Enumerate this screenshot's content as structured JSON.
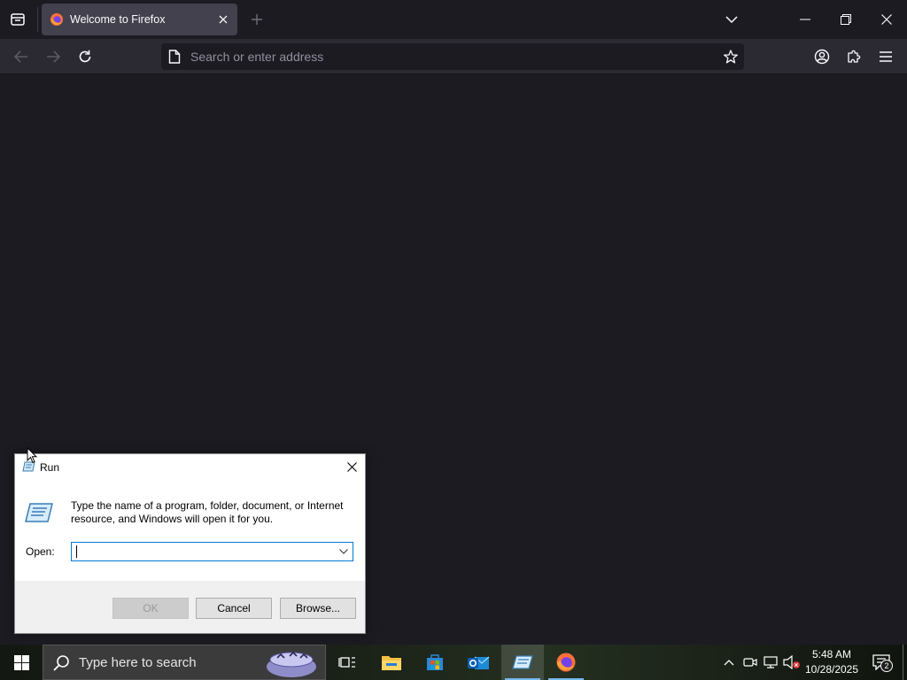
{
  "browser": {
    "tab_title": "Welcome to Firefox",
    "address_placeholder": "Search or enter address"
  },
  "run_dialog": {
    "title": "Run",
    "description": "Type the name of a program, folder, document, or Internet resource, and Windows will open it for you.",
    "open_label": "Open:",
    "open_value": "",
    "ok_label": "OK",
    "cancel_label": "Cancel",
    "browse_label": "Browse..."
  },
  "taskbar": {
    "search_placeholder": "Type here to search",
    "time": "5:48 AM",
    "date": "10/28/2025",
    "notification_count": "2",
    "pinned": [
      "task-view",
      "file-explorer",
      "microsoft-store",
      "outlook",
      "run",
      "firefox"
    ]
  },
  "colors": {
    "firefox_bg": "#1c1b22",
    "toolbar_bg": "#2b2a33",
    "tab_active": "#42414d",
    "accent": "#0078d7"
  }
}
